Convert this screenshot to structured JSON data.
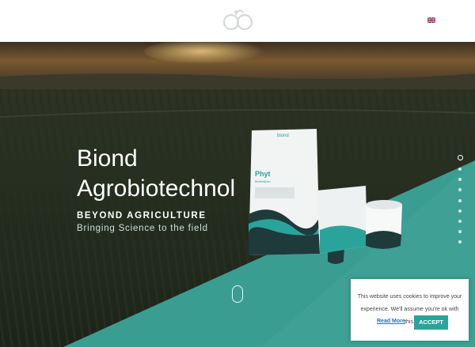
{
  "header": {
    "logo_icon": "biond-logo-icon",
    "language_icon": "uk-flag-icon"
  },
  "hero": {
    "title_line1": "Biond",
    "title_line2": "Agrobiotechnol",
    "tagline": "BEYOND AGRICULTURE",
    "subtitle": "Bringing Science to the field",
    "slider_dots": 9,
    "active_slide": 1
  },
  "products": {
    "bag_brand": "biond",
    "bag_product": "Phyt",
    "bag_subtitle": "Biofertilizer"
  },
  "cookie": {
    "message": "This website uses cookies to improve your experience. We'll assume you're ok with this.",
    "read_more_label": "Read More",
    "accept_label": "ACCEPT"
  },
  "colors": {
    "accent": "#2aa49b",
    "teal_band": "#3a9d92",
    "link": "#1e73be"
  }
}
